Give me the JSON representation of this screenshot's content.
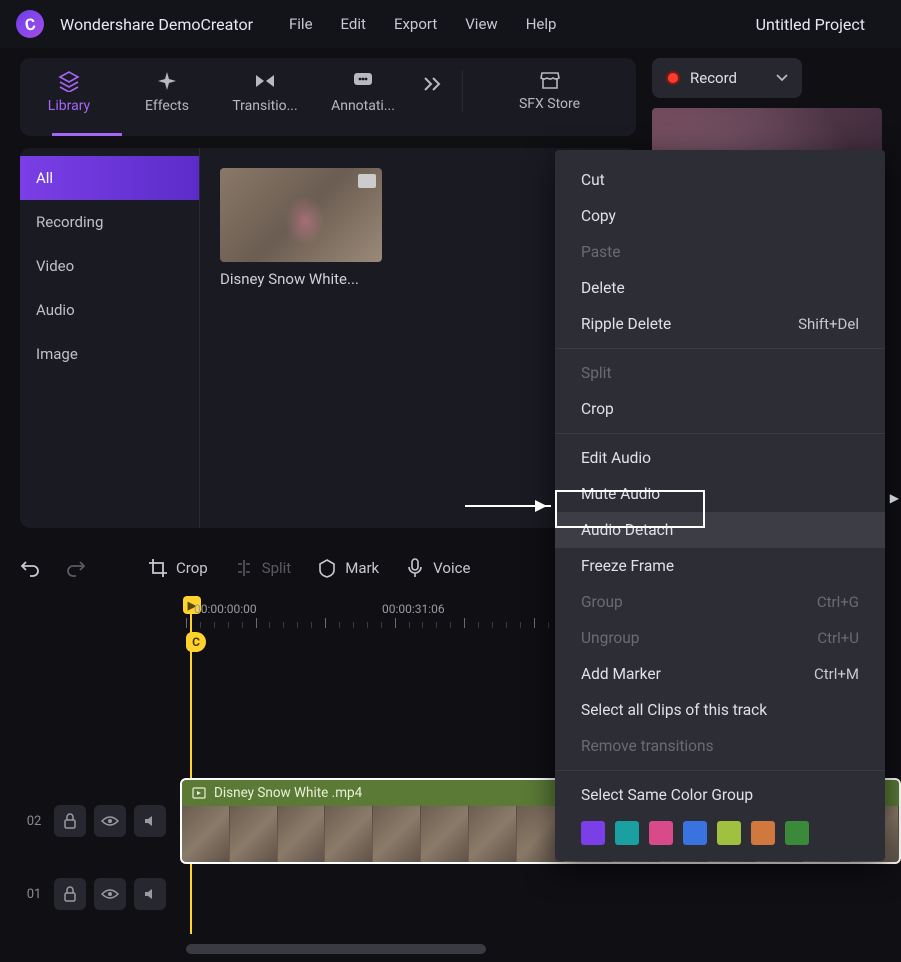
{
  "app": {
    "name": "Wondershare DemoCreator",
    "project": "Untitled Project"
  },
  "menu": {
    "file": "File",
    "edit": "Edit",
    "export": "Export",
    "view": "View",
    "help": "Help"
  },
  "tabs": {
    "library": "Library",
    "effects": "Effects",
    "transitions": "Transitio...",
    "annotations": "Annotati...",
    "sfx": "SFX Store"
  },
  "record_label": "Record",
  "sidebar": {
    "all": "All",
    "recording": "Recording",
    "video": "Video",
    "audio": "Audio",
    "image": "Image"
  },
  "thumb": {
    "label": "Disney Snow White..."
  },
  "toolbar": {
    "crop": "Crop",
    "split": "Split",
    "mark": "Mark",
    "voice": "Voice"
  },
  "ruler": {
    "t0": "00:00:00:00",
    "t1": "00:00:31:06"
  },
  "tracks": {
    "t02": "02",
    "t01": "01"
  },
  "clip": {
    "filename": "Disney Snow White .mp4"
  },
  "ctx": {
    "cut": "Cut",
    "copy": "Copy",
    "paste": "Paste",
    "delete": "Delete",
    "ripple_delete": "Ripple Delete",
    "ripple_delete_sc": "Shift+Del",
    "split": "Split",
    "crop": "Crop",
    "edit_audio": "Edit Audio",
    "mute_audio": "Mute Audio",
    "audio_detach": "Audio Detach",
    "freeze": "Freeze Frame",
    "group": "Group",
    "group_sc": "Ctrl+G",
    "ungroup": "Ungroup",
    "ungroup_sc": "Ctrl+U",
    "add_marker": "Add Marker",
    "add_marker_sc": "Ctrl+M",
    "select_all": "Select all Clips of this track",
    "remove_trans": "Remove transitions",
    "select_color": "Select Same Color Group"
  },
  "colors": [
    "#7a3fe6",
    "#1aa0a0",
    "#d94a8a",
    "#3a72e0",
    "#a0c040",
    "#d0783e",
    "#3a8a3a"
  ]
}
